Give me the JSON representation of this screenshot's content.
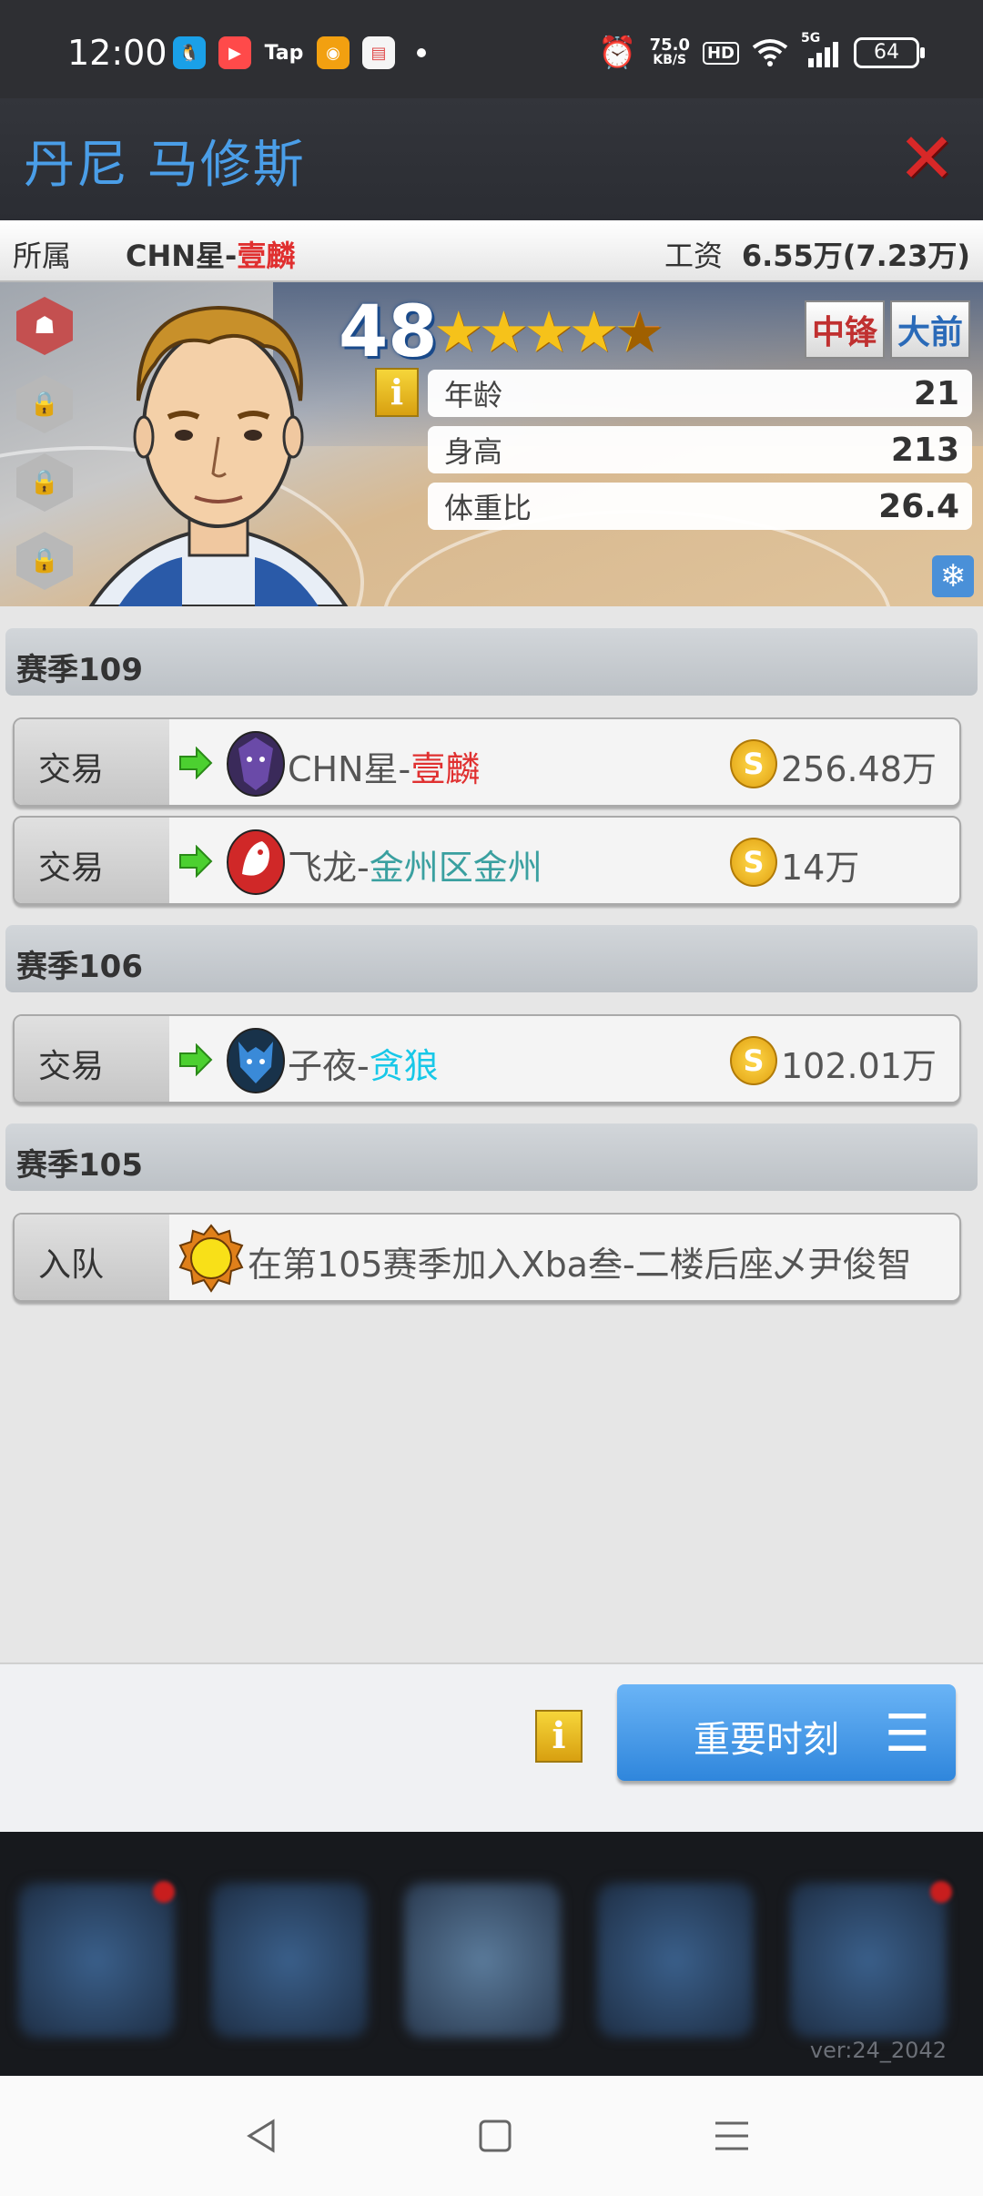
{
  "status_bar": {
    "time": "12:00",
    "apps": [
      "qq-icon",
      "kuaishou-icon",
      "Tap",
      "weibo-icon",
      "wallet-icon"
    ],
    "speed_value": "75.0",
    "speed_unit": "KB/S",
    "hd": "HD",
    "network": "5G",
    "battery": "64"
  },
  "header": {
    "title": "丹尼 马修斯"
  },
  "info_row": {
    "team_label": "所属",
    "team_prefix": "CHN星-",
    "team_name": "壹麟",
    "salary_label": "工资",
    "salary_value": "6.55万(7.23万)"
  },
  "player": {
    "rating": "48",
    "stars": 4.5,
    "positions": [
      "中锋",
      "大前"
    ],
    "stats": [
      {
        "label": "年龄",
        "value": "21"
      },
      {
        "label": "身高",
        "value": "213"
      },
      {
        "label": "体重比",
        "value": "26.4"
      }
    ],
    "badges_locked": 3
  },
  "history": {
    "seasons": [
      {
        "title": "赛季109",
        "entries": [
          {
            "type": "交易",
            "team_prefix": "CHN星-",
            "team_name": "壹麟",
            "fee": "256.48万"
          },
          {
            "type": "交易",
            "team_prefix": "飞龙-",
            "team_name": "金州区金州",
            "fee": "14万"
          }
        ]
      },
      {
        "title": "赛季106",
        "entries": [
          {
            "type": "交易",
            "team_prefix": "子夜-",
            "team_name": "贪狼",
            "fee": "102.01万"
          }
        ]
      },
      {
        "title": "赛季105",
        "entries": [
          {
            "type": "入队",
            "text": "在第105赛季加入Xba叁-二楼后座乄尹俊智"
          }
        ]
      }
    ]
  },
  "footer": {
    "moments_label": "重要时刻"
  },
  "game_nav": {
    "version": "ver:24_2042"
  },
  "colors": {
    "title_blue": "#4a9ee8",
    "team_red": "#e03030",
    "team_teal": "#3aa0a0",
    "team_cyan": "#18c8e8",
    "button_blue": "#2f86dc"
  }
}
